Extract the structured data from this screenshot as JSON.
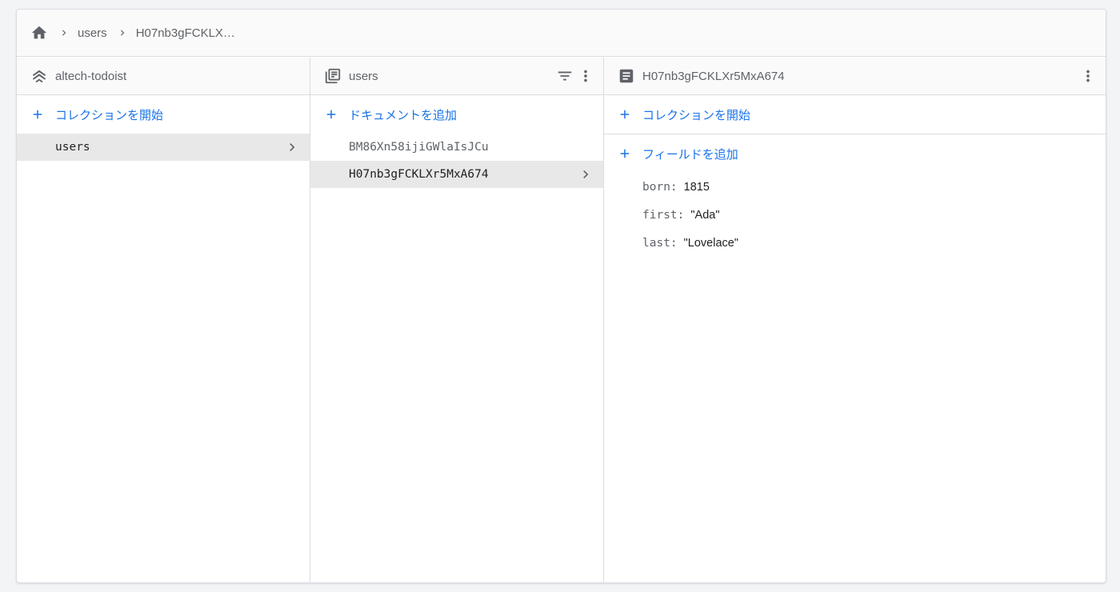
{
  "breadcrumb": {
    "items": [
      "users",
      "H07nb3gFCKLX…"
    ]
  },
  "panel_root": {
    "title": "altech-todoist",
    "add_label": "コレクションを開始",
    "items": [
      {
        "label": "users",
        "selected": true
      }
    ]
  },
  "panel_collection": {
    "title": "users",
    "add_label": "ドキュメントを追加",
    "items": [
      {
        "label": "BM86Xn58ijiGWlaIsJCu",
        "selected": false
      },
      {
        "label": "H07nb3gFCKLXr5MxA674",
        "selected": true
      }
    ]
  },
  "panel_document": {
    "title": "H07nb3gFCKLXr5MxA674",
    "add_collection_label": "コレクションを開始",
    "add_field_label": "フィールドを追加",
    "fields": [
      {
        "key": "born:",
        "value": "1815"
      },
      {
        "key": "first:",
        "value": "\"Ada\""
      },
      {
        "key": "last:",
        "value": "\"Lovelace\""
      }
    ]
  },
  "colors": {
    "accent": "#1a73e8",
    "icon_gray": "#5f6368",
    "selected_bg": "#e8e8e8"
  }
}
